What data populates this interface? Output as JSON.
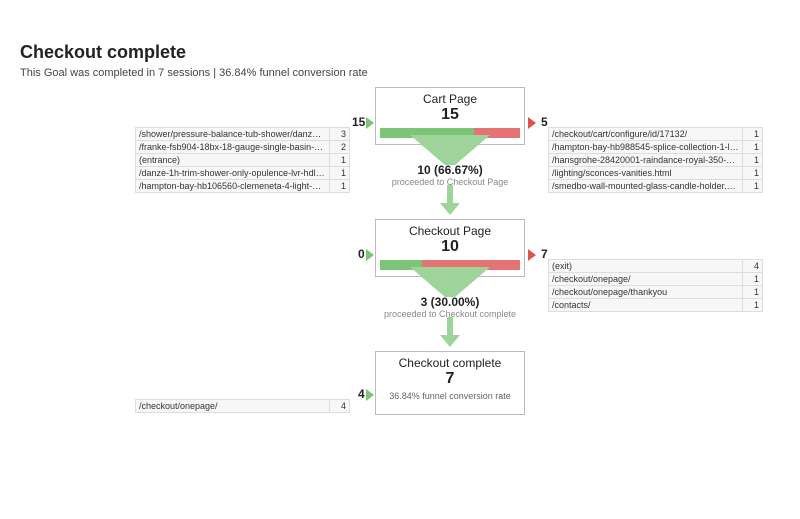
{
  "header": {
    "title": "Checkout complete",
    "subtitle": "This Goal was completed in 7 sessions | 36.84% funnel conversion rate"
  },
  "steps": [
    {
      "title": "Cart Page",
      "count": "15",
      "in": "15",
      "out": "5",
      "green_pct": 67,
      "red_pct": 33,
      "proceed_number": "10 (66.67%)",
      "proceed_label": "proceeded to Checkout Page",
      "in_table": [
        {
          "path": "/shower/pressure-balance-tub-shower/danze-1h-trim-t-s...",
          "n": "3"
        },
        {
          "path": "/franke-fsb904-18bx-18-gauge-single-basin-drop-in-stai...",
          "n": "2"
        },
        {
          "path": "(entrance)",
          "n": "1"
        },
        {
          "path": "/danze-1h-trim-shower-only-opulence-lvr-hdl.html",
          "n": "1"
        },
        {
          "path": "/hampton-bay-hb106560-clemeneta-4-light-hanging-sati...",
          "n": "1"
        }
      ],
      "out_table": [
        {
          "path": "/checkout/cart/configure/id/17132/",
          "n": "1"
        },
        {
          "path": "/hampton-bay-hb988545-splice-collection-1-light-chrom...",
          "n": "1"
        },
        {
          "path": "/hansgrohe-28420001-raindance-royal-350-air-shower-h...",
          "n": "1"
        },
        {
          "path": "/lighting/sconces-vanities.html",
          "n": "1"
        },
        {
          "path": "/smedbo-wall-mounted-glass-candle-holder.html",
          "n": "1"
        }
      ]
    },
    {
      "title": "Checkout Page",
      "count": "10",
      "in": "0",
      "out": "7",
      "green_pct": 30,
      "red_pct": 70,
      "proceed_number": "3 (30.00%)",
      "proceed_label": "proceeded to Checkout complete",
      "in_table": [],
      "out_table": [
        {
          "path": "(exit)",
          "n": "4"
        },
        {
          "path": "/checkout/onepage/",
          "n": "1"
        },
        {
          "path": "/checkout/onepage/thankyou",
          "n": "1"
        },
        {
          "path": "/contacts/",
          "n": "1"
        }
      ]
    },
    {
      "title": "Checkout complete",
      "count": "7",
      "in": "4",
      "out": "",
      "footnote": "36.84% funnel conversion rate",
      "in_table": [
        {
          "path": "/checkout/onepage/",
          "n": "4"
        }
      ],
      "out_table": []
    }
  ]
}
